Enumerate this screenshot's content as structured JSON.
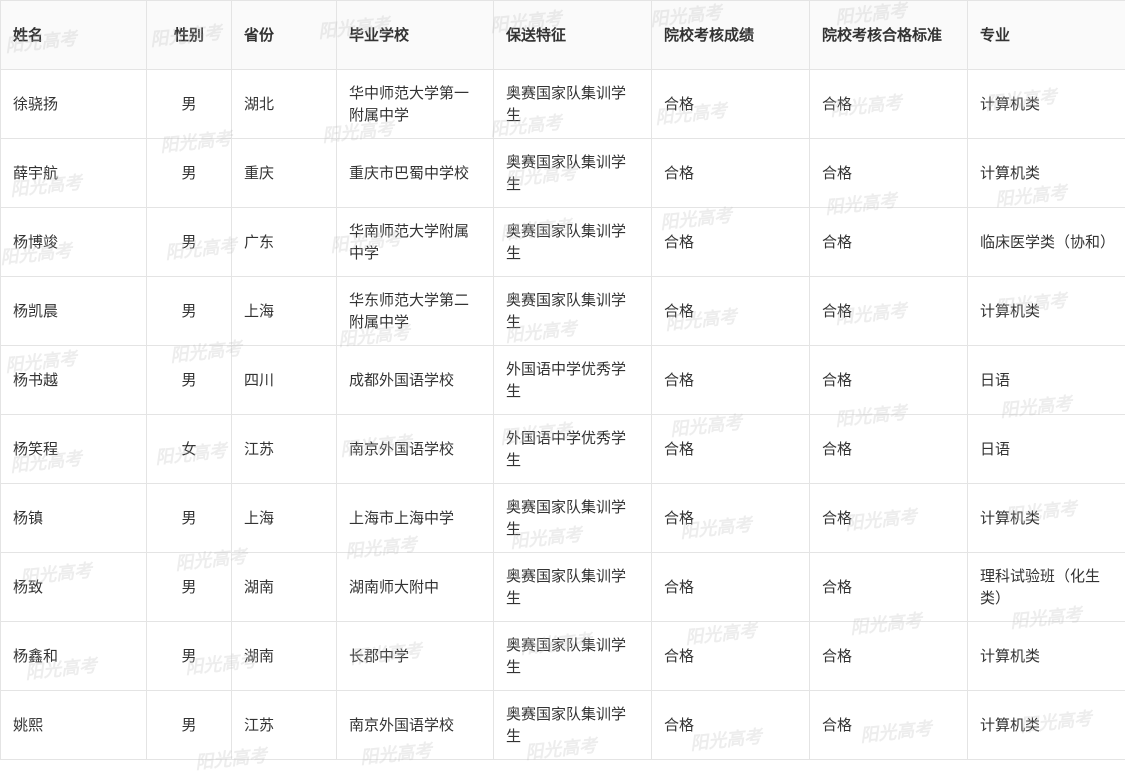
{
  "table": {
    "columns": [
      "姓名",
      "性别",
      "省份",
      "毕业学校",
      "保送特征",
      "院校考核成绩",
      "院校考核合格标准",
      "专业"
    ],
    "rows": [
      [
        "徐骁扬",
        "男",
        "湖北",
        "华中师范大学第一附属中学",
        "奥赛国家队集训学生",
        "合格",
        "合格",
        "计算机类"
      ],
      [
        "薛宇航",
        "男",
        "重庆",
        "重庆市巴蜀中学校",
        "奥赛国家队集训学生",
        "合格",
        "合格",
        "计算机类"
      ],
      [
        "杨博竣",
        "男",
        "广东",
        "华南师范大学附属中学",
        "奥赛国家队集训学生",
        "合格",
        "合格",
        "临床医学类（协和）"
      ],
      [
        "杨凯晨",
        "男",
        "上海",
        "华东师范大学第二附属中学",
        "奥赛国家队集训学生",
        "合格",
        "合格",
        "计算机类"
      ],
      [
        "杨书越",
        "男",
        "四川",
        "成都外国语学校",
        "外国语中学优秀学生",
        "合格",
        "合格",
        "日语"
      ],
      [
        "杨笑程",
        "女",
        "江苏",
        "南京外国语学校",
        "外国语中学优秀学生",
        "合格",
        "合格",
        "日语"
      ],
      [
        "杨镇",
        "男",
        "上海",
        "上海市上海中学",
        "奥赛国家队集训学生",
        "合格",
        "合格",
        "计算机类"
      ],
      [
        "杨致",
        "男",
        "湖南",
        "湖南师大附中",
        "奥赛国家队集训学生",
        "合格",
        "合格",
        "理科试验班（化生类）"
      ],
      [
        "杨鑫和",
        "男",
        "湖南",
        "长郡中学",
        "奥赛国家队集训学生",
        "合格",
        "合格",
        "计算机类"
      ],
      [
        "姚熙",
        "男",
        "江苏",
        "南京外国语学校",
        "奥赛国家队集训学生",
        "合格",
        "合格",
        "计算机类"
      ]
    ]
  },
  "watermark": {
    "text": "阳光高考"
  }
}
